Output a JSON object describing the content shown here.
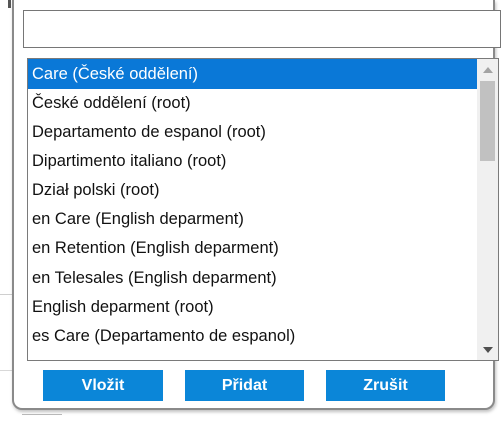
{
  "filter": {
    "value": "",
    "placeholder": ""
  },
  "list": {
    "selected_index": 0,
    "items": [
      "Care (České oddělení)",
      "České oddělení (root)",
      "Departamento de espanol (root)",
      "Dipartimento italiano (root)",
      "Dział polski (root)",
      "en Care (English deparment)",
      "en Retention (English deparment)",
      "en Telesales (English deparment)",
      "English deparment (root)",
      "es Care (Departamento de espanol)"
    ]
  },
  "buttons": {
    "insert_label": "Vložit",
    "add_label": "Přidat",
    "cancel_label": "Zrušit"
  },
  "colors": {
    "selection": "#0a78d7",
    "button": "#0b86d8",
    "border": "#8a8a8a"
  },
  "icons": {
    "scroll_up": "triangle-up",
    "scroll_down": "triangle-down"
  }
}
